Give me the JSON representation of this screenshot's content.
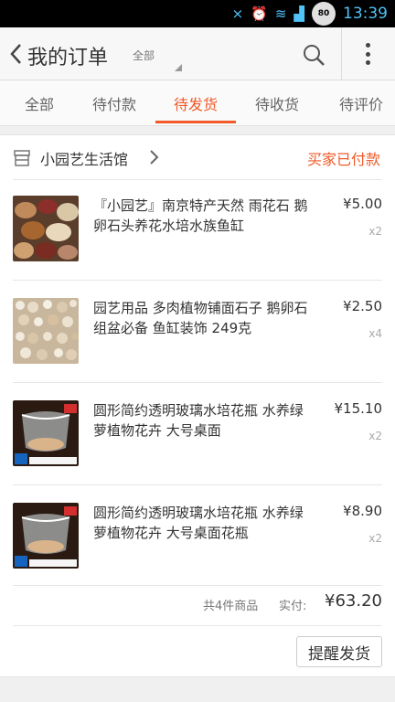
{
  "statusbar": {
    "time": "13:39",
    "battery": "80"
  },
  "appbar": {
    "title": "我的订单",
    "filter": "全部"
  },
  "tabs": [
    {
      "label": "全部"
    },
    {
      "label": "待付款"
    },
    {
      "label": "待发货"
    },
    {
      "label": "待收货"
    },
    {
      "label": "待评价"
    }
  ],
  "order": {
    "shop_name": "小园艺生活馆",
    "status": "买家已付款",
    "items": [
      {
        "title": "『小园艺』南京特产天然 雨花石 鹅卵石头养花水培水族鱼缸",
        "price": "¥5.00",
        "qty": "x2"
      },
      {
        "title": "园艺用品 多肉植物铺面石子 鹅卵石组盆必备 鱼缸装饰 249克",
        "price": "¥2.50",
        "qty": "x4"
      },
      {
        "title": "圆形简约透明玻璃水培花瓶 水养绿萝植物花卉 大号桌面",
        "price": "¥15.10",
        "qty": "x2"
      },
      {
        "title": "圆形简约透明玻璃水培花瓶 水养绿萝植物花卉 大号桌面花瓶",
        "price": "¥8.90",
        "qty": "x2"
      }
    ],
    "summary": {
      "count_text": "共4件商品",
      "paid_label": "实付:",
      "paid_amount": "¥63.20"
    },
    "action": "提醒发货"
  }
}
